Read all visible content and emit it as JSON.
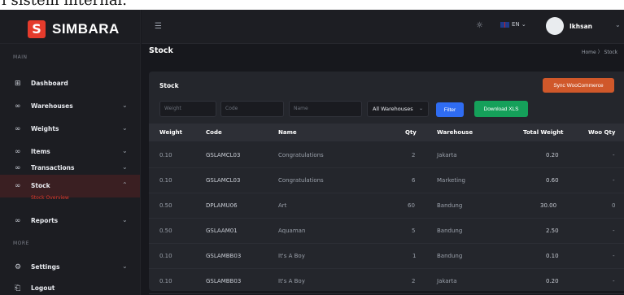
{
  "doc_strip_text": "i sistem internal.",
  "brand": {
    "logo_letter": "S",
    "name": "SIMBARA"
  },
  "sidebar": {
    "main_label": "MAIN",
    "more_label": "MORE",
    "items": [
      {
        "label": "Dashboard",
        "icon": "grid-icon"
      },
      {
        "label": "Warehouses",
        "icon": "warehouse-icon"
      },
      {
        "label": "Weights",
        "icon": "weight-icon"
      },
      {
        "label": "Items",
        "icon": "items-icon"
      },
      {
        "label": "Transactions",
        "icon": "transactions-icon"
      },
      {
        "label": "Stock",
        "icon": "stock-icon"
      },
      {
        "label": "Reports",
        "icon": "reports-icon"
      },
      {
        "label": "Settings",
        "icon": "gear-icon"
      },
      {
        "label": "Logout",
        "icon": "logout-icon"
      }
    ],
    "sub_item": "Stock Overview"
  },
  "header": {
    "language": "EN",
    "user_name": "Ikhsan"
  },
  "page": {
    "title": "Stock",
    "breadcrumb": "Home  〉 Stock"
  },
  "card": {
    "title": "Stock",
    "sync_button": "Sync WooCommerce",
    "filters": {
      "weight_placeholder": "Weight",
      "code_placeholder": "Code",
      "name_placeholder": "Name",
      "warehouse_select": "All Warehouses",
      "filter_button": "Filter",
      "download_button": "Download XLS"
    },
    "columns": [
      "Weight",
      "Code",
      "Name",
      "Qty",
      "Warehouse",
      "Total Weight",
      "Woo Qty"
    ],
    "rows": [
      [
        "0.10",
        "GSLAMCL03",
        "Congratulations",
        "2",
        "Jakarta",
        "0.20",
        "-"
      ],
      [
        "0.10",
        "GSLAMCL03",
        "Congratulations",
        "6",
        "Marketing",
        "0.60",
        "-"
      ],
      [
        "0.50",
        "DPLAMU06",
        "Art",
        "60",
        "Bandung",
        "30.00",
        "0"
      ],
      [
        "0.50",
        "GSLAAM01",
        "Aquaman",
        "5",
        "Bandung",
        "2.50",
        "-"
      ],
      [
        "0.10",
        "GSLAMBB03",
        "It's A Boy",
        "1",
        "Bandung",
        "0.10",
        "-"
      ],
      [
        "0.10",
        "GSLAMBB03",
        "It's A Boy",
        "2",
        "Jakarta",
        "0.20",
        "-"
      ]
    ]
  },
  "colors": {
    "accent_red": "#e53b2c",
    "sync_orange": "#d0582a",
    "filter_blue": "#2f6cf2",
    "xls_green": "#15a05a"
  }
}
